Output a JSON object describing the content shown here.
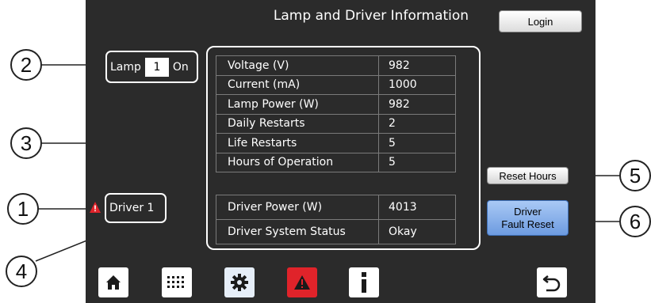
{
  "header": {
    "title": "Lamp and Driver Information",
    "login_label": "Login"
  },
  "lamp": {
    "label": "Lamp",
    "number": "1",
    "state": "On"
  },
  "driver": {
    "label": "Driver 1"
  },
  "lamp_table": [
    {
      "label": "Voltage (V)",
      "value": "982"
    },
    {
      "label": "Current (mA)",
      "value": "1000"
    },
    {
      "label": "Lamp Power (W)",
      "value": "982"
    },
    {
      "label": "Daily Restarts",
      "value": "2"
    },
    {
      "label": "Life Restarts",
      "value": "5"
    },
    {
      "label": "Hours of Operation",
      "value": "5"
    }
  ],
  "driver_table": [
    {
      "label": "Driver Power (W)",
      "value": "4013"
    },
    {
      "label": "Driver System Status",
      "value": "Okay"
    }
  ],
  "buttons": {
    "reset_hours": "Reset Hours",
    "fault_reset_line1": "Driver",
    "fault_reset_line2": "Fault Reset"
  },
  "nav_icons": [
    "home-icon",
    "keypad-icon",
    "gear-icon",
    "warning-icon",
    "info-icon",
    "back-icon"
  ],
  "callouts": [
    "1",
    "2",
    "3",
    "4",
    "5",
    "6"
  ],
  "colors": {
    "screen_bg": "#2b2b2b",
    "warning_red": "#e0232a",
    "fault_blue": "#6d9be0"
  }
}
